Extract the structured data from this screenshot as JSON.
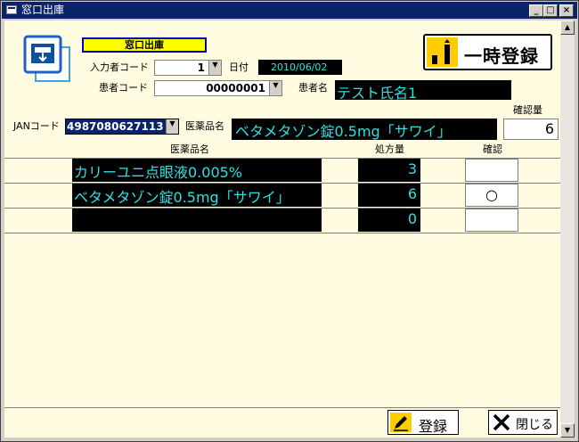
{
  "window": {
    "title": "窓口出庫"
  },
  "header": {
    "badge": "窓口出庫",
    "input_code_label": "入力者コード",
    "input_code_value": "1",
    "date_label": "日付",
    "date_value": "2010/06/02",
    "patient_code_label": "患者コード",
    "patient_code_value": "00000001",
    "patient_name_label": "患者名",
    "patient_name_value": "テスト氏名1",
    "temp_register_label": "一時登録"
  },
  "entry": {
    "jan_label": "JANコード",
    "jan_value": "4987080627113",
    "drug_name_label": "医薬品名",
    "drug_name_value": "ベタメタゾン錠0.5mg「サワイ」",
    "confirm_qty_label": "確認量",
    "confirm_qty_value": "6"
  },
  "table": {
    "headers": {
      "drug": "医薬品名",
      "qty": "処方量",
      "check": "確認"
    },
    "rows": [
      {
        "drug": "カリーユニ点眼液0.005%",
        "qty": "3",
        "check": ""
      },
      {
        "drug": "ベタメタゾン錠0.5mg「サワイ」",
        "qty": "6",
        "check": "○"
      },
      {
        "drug": "",
        "qty": "0",
        "check": ""
      }
    ]
  },
  "footer": {
    "register_label": "登録",
    "close_label": "閉じる"
  },
  "colors": {
    "accent_text": "#30e0e0",
    "field_bg": "#000000",
    "client_bg": "#fffbe0",
    "badge_bg": "#ffff00",
    "badge_border": "#0000c0",
    "titlebar": "#0a246a"
  }
}
